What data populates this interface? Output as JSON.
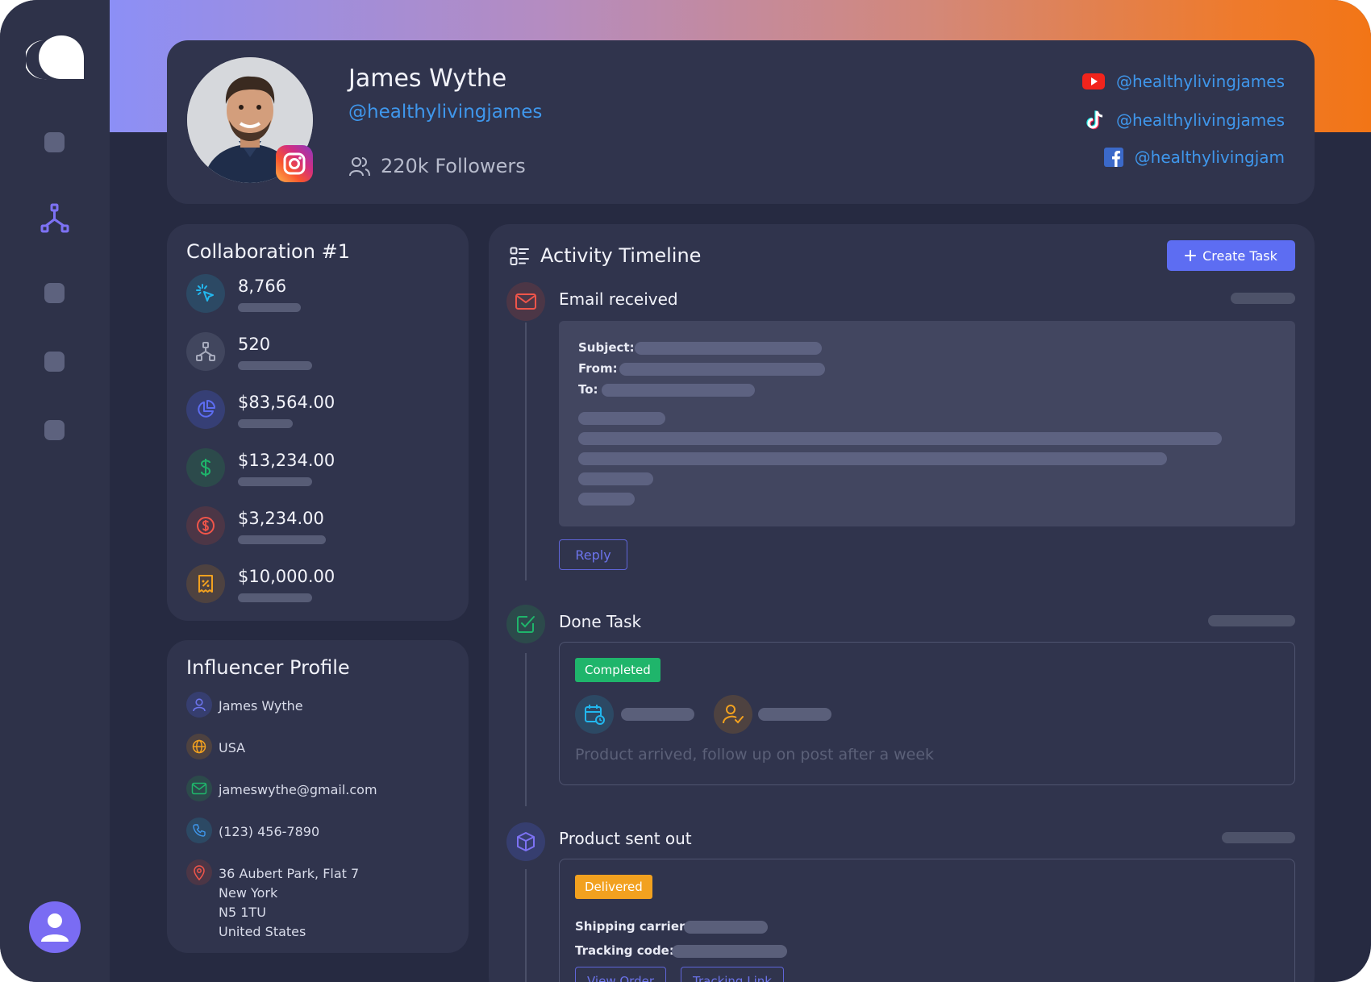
{
  "profile": {
    "name": "James Wythe",
    "handle": "@healthylivingjames",
    "followers": "220k Followers",
    "socials": [
      {
        "network": "youtube",
        "handle": "@healthylivingjames"
      },
      {
        "network": "tiktok",
        "handle": "@healthylivingjames"
      },
      {
        "network": "facebook",
        "handle": "@healthylivingjam"
      }
    ]
  },
  "collaboration": {
    "title": "Collaboration #1",
    "stats": [
      {
        "icon": "cursor-click-icon",
        "value": "8,766"
      },
      {
        "icon": "network-icon",
        "value": "520"
      },
      {
        "icon": "pie-chart-icon",
        "value": "$83,564.00"
      },
      {
        "icon": "dollar-icon",
        "value": "$13,234.00"
      },
      {
        "icon": "dollar-circle-icon",
        "value": "$3,234.00"
      },
      {
        "icon": "receipt-icon",
        "value": "$10,000.00"
      }
    ]
  },
  "influencer": {
    "title": "Influencer Profile",
    "name": "James Wythe",
    "country": "USA",
    "email": "jameswythe@gmail.com",
    "phone": "(123) 456-7890",
    "address": [
      "36 Aubert Park, Flat 7",
      "New York",
      "N5 1TU",
      "United States"
    ]
  },
  "timeline": {
    "title": "Activity Timeline",
    "create_label": "Create Task",
    "email": {
      "title": "Email received",
      "subject_label": "Subject:",
      "from_label": "From:",
      "to_label": "To:",
      "reply_label": "Reply"
    },
    "done": {
      "title": "Done Task",
      "badge": "Completed",
      "note": "Product arrived, follow up on post after a week"
    },
    "product": {
      "title": "Product sent out",
      "badge": "Delivered",
      "carrier_label": "Shipping carrier:",
      "tracking_label": "Tracking code:",
      "view_order_label": "View Order",
      "tracking_link_label": "Tracking Link"
    }
  },
  "colors": {
    "accent": "#5d6df2",
    "completed": "#1fb56b",
    "delivered": "#f2a11f",
    "link": "#3f97ec"
  }
}
